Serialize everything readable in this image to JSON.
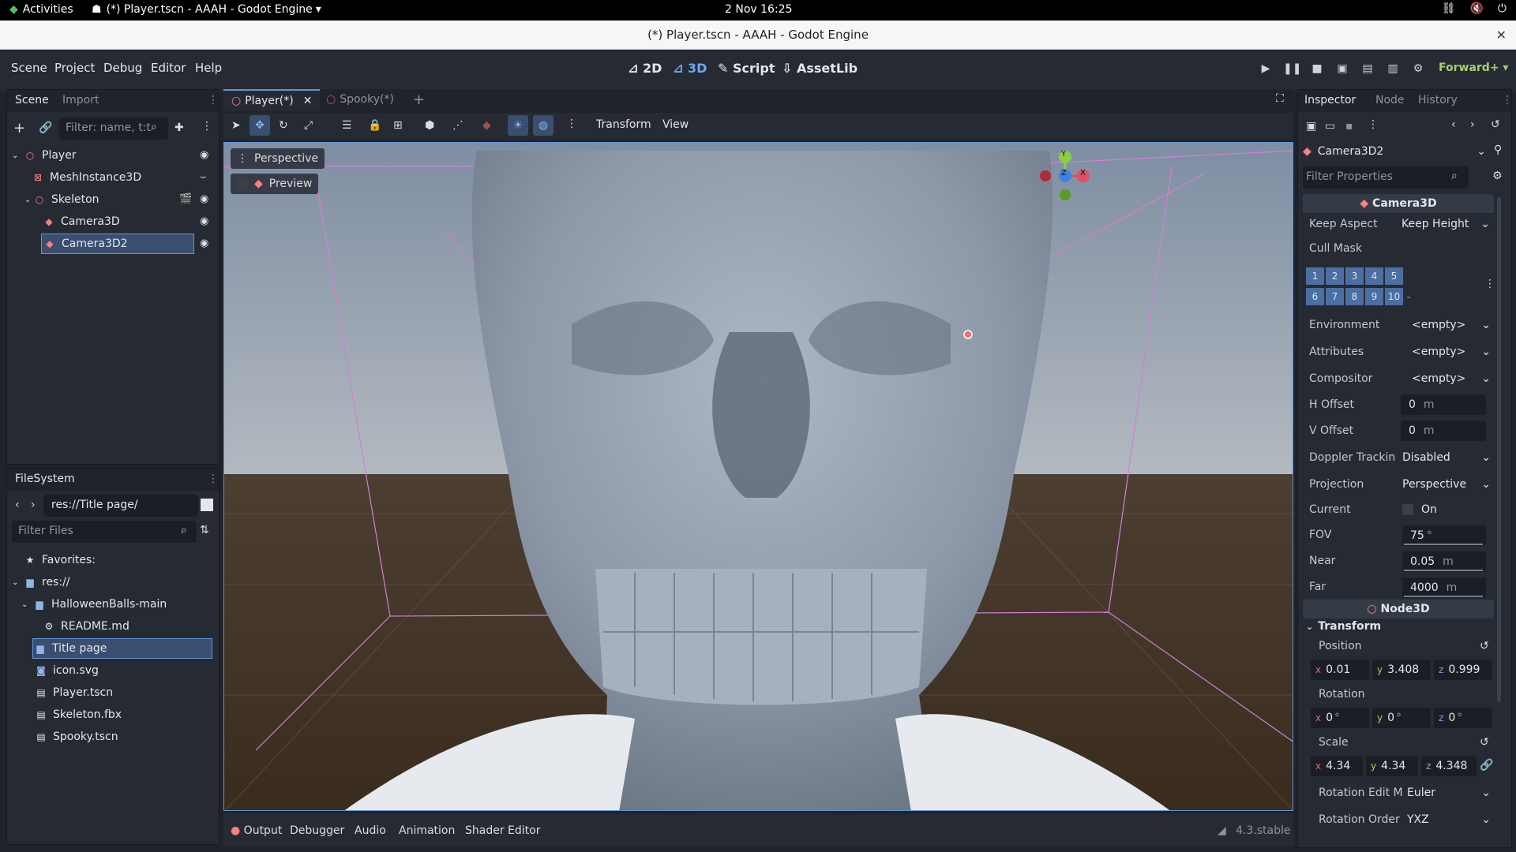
{
  "system_bar": {
    "activities": "Activities",
    "app_title": "(*) Player.tscn - AAAH - Godot Engine",
    "clock": "2 Nov  16:25"
  },
  "window": {
    "title": "(*) Player.tscn - AAAH - Godot Engine",
    "close": "×"
  },
  "menu": [
    "Scene",
    "Project",
    "Debug",
    "Editor",
    "Help"
  ],
  "modes": {
    "m2d": "2D",
    "m3d": "3D",
    "script": "Script",
    "assetlib": "AssetLib"
  },
  "renderer": "Forward+",
  "scene_dock": {
    "tabs": [
      "Scene",
      "Import"
    ],
    "filter_placeholder": "Filter: name, t:t",
    "nodes": [
      {
        "label": "Player",
        "icon": "node3d-icon"
      },
      {
        "label": "MeshInstance3D",
        "icon": "mesh-icon"
      },
      {
        "label": "Skeleton",
        "icon": "skeleton-icon"
      },
      {
        "label": "Camera3D",
        "icon": "camera-icon"
      },
      {
        "label": "Camera3D2",
        "icon": "camera-icon"
      }
    ]
  },
  "filesystem": {
    "tab": "FileSystem",
    "path": "res://Title page/",
    "filter_placeholder": "Filter Files",
    "items": [
      "Favorites:",
      "res://",
      "HalloweenBalls-main",
      "README.md",
      "Title page",
      "icon.svg",
      "Player.tscn",
      "Skeleton.fbx",
      "Spooky.tscn"
    ]
  },
  "editor_tabs": [
    "Player(*)",
    "Spooky(*)"
  ],
  "viewport_toolbar": {
    "transform": "Transform",
    "view": "View"
  },
  "viewport": {
    "perspective": "Perspective",
    "preview": "Preview"
  },
  "gizmo": {
    "y": "Y",
    "z": "Z",
    "x": "X"
  },
  "bottom_tabs": [
    "Output",
    "Debugger",
    "Audio",
    "Animation",
    "Shader Editor"
  ],
  "version": "4.3.stable",
  "inspector": {
    "tabs": [
      "Inspector",
      "Node",
      "History"
    ],
    "object": "Camera3D2",
    "filter_placeholder": "Filter Properties",
    "section_camera": "Camera3D",
    "keep_aspect_label": "Keep Aspect",
    "keep_aspect_value": "Keep Height",
    "cull_mask_label": "Cull Mask",
    "cull_layers": [
      "1",
      "2",
      "3",
      "4",
      "5",
      "6",
      "7",
      "8",
      "9",
      "10"
    ],
    "environment_label": "Environment",
    "attributes_label": "Attributes",
    "compositor_label": "Compositor",
    "empty": "<empty>",
    "h_offset_label": "H Offset",
    "h_offset_value": "0",
    "v_offset_label": "V Offset",
    "v_offset_value": "0",
    "unit_m": "m",
    "doppler_label": "Doppler Trackin",
    "doppler_value": "Disabled",
    "projection_label": "Projection",
    "projection_value": "Perspective",
    "current_label": "Current",
    "current_value": "On",
    "fov_label": "FOV",
    "fov_value": "75",
    "near_label": "Near",
    "near_value": "0.05",
    "far_label": "Far",
    "far_value": "4000",
    "section_node3d": "Node3D",
    "transform_label": "Transform",
    "position_label": "Position",
    "position": {
      "x": "0.01",
      "y": "3.408",
      "z": "0.999"
    },
    "rotation_label": "Rotation",
    "rotation": {
      "x": "0",
      "y": "0",
      "z": "0"
    },
    "scale_label": "Scale",
    "scale": {
      "x": "4.34",
      "y": "4.34",
      "z": "4.348"
    },
    "rot_edit_label": "Rotation Edit M",
    "rot_edit_value": "Euler",
    "rot_order_label": "Rotation Order",
    "rot_order_value": "YXZ",
    "deg": "°"
  }
}
